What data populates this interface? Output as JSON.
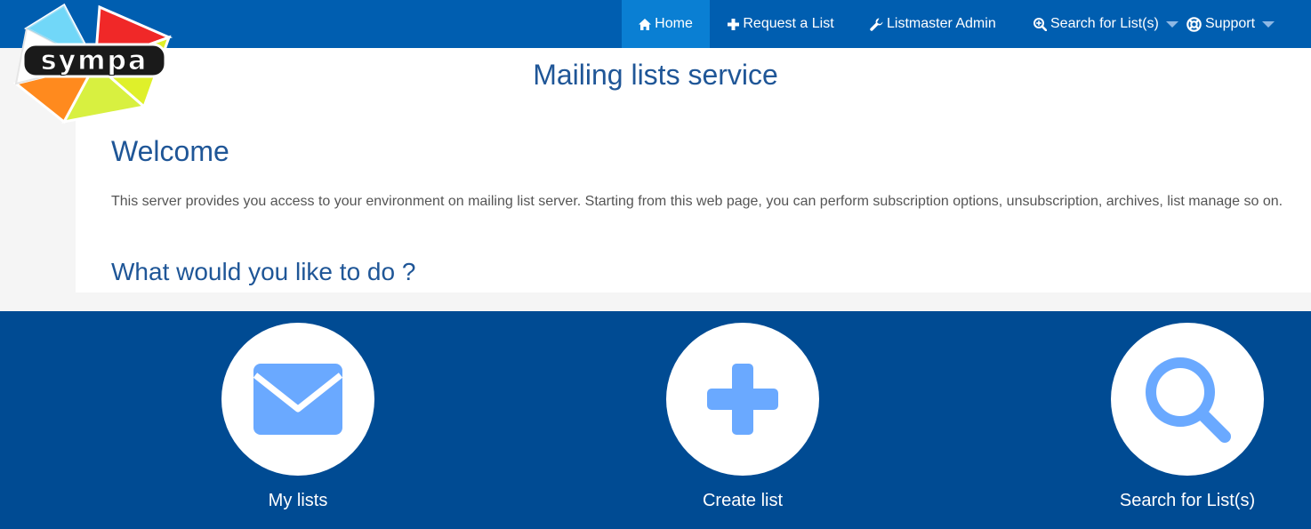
{
  "nav": {
    "items": [
      {
        "label": "Home",
        "icon": "home-icon",
        "active": true
      },
      {
        "label": "Request a List",
        "icon": "plus-icon",
        "active": false
      },
      {
        "label": "Listmaster Admin",
        "icon": "wrench-icon",
        "active": false
      },
      {
        "label": "Search for List(s)",
        "icon": "search-plus-icon",
        "active": false,
        "dropdown": true
      },
      {
        "label": "Support",
        "icon": "lifebuoy-icon",
        "active": false,
        "dropdown": true
      }
    ]
  },
  "logo": {
    "text": "sympa"
  },
  "main": {
    "service_title": "Mailing lists service",
    "welcome_heading": "Welcome",
    "intro_text": "This server provides you access to your environment on mailing list server. Starting from this web page, you can perform subscription options, unsubscription, archives, list manage so on.",
    "question_heading": "What would you like to do ?"
  },
  "actions": [
    {
      "label": "My lists",
      "icon": "envelope-icon"
    },
    {
      "label": "Create list",
      "icon": "plus-icon"
    },
    {
      "label": "Search for List(s)",
      "icon": "search-icon"
    }
  ],
  "colors": {
    "navbar": "#005eb0",
    "nav_active": "#0a7fd3",
    "action_band": "#004b93",
    "heading": "#1f5697",
    "icon_blue": "#6aa9ff"
  }
}
